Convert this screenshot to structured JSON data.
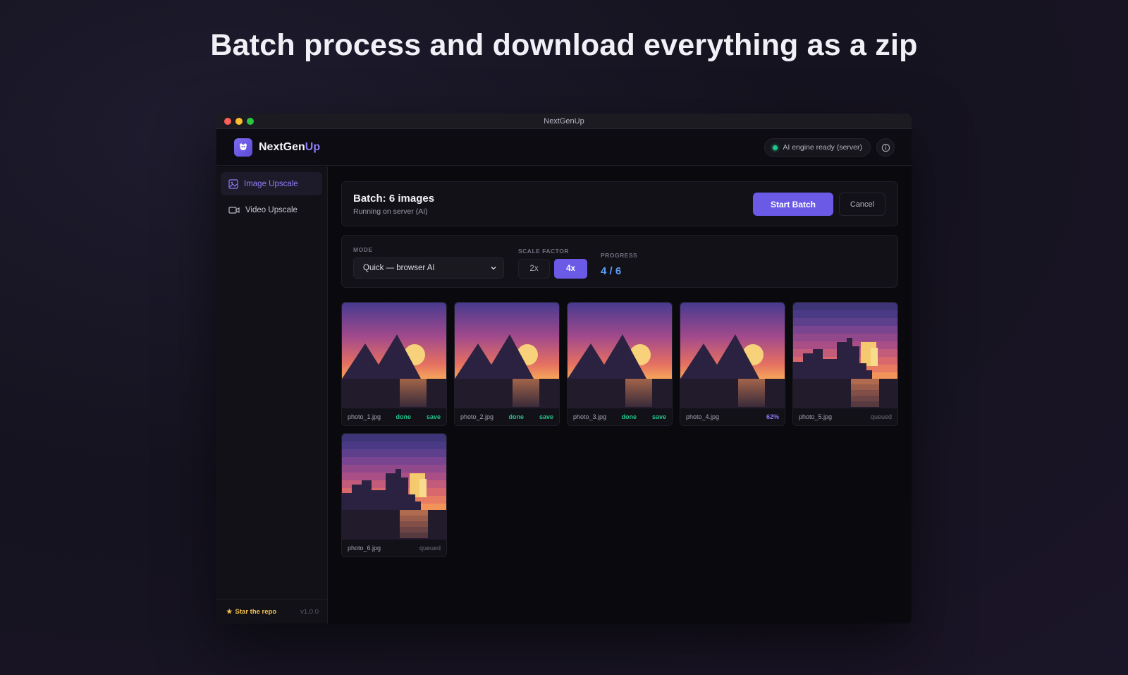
{
  "headline": "Batch process and download everything as a zip",
  "window": {
    "title": "NextGenUp"
  },
  "header": {
    "brand_main": "NextGen",
    "brand_accent": "Up",
    "engine_status": "AI engine ready (server)",
    "info_icon": "info-icon"
  },
  "sidebar": {
    "items": [
      {
        "label": "Image Upscale",
        "icon": "image-icon",
        "active": true
      },
      {
        "label": "Video Upscale",
        "icon": "video-icon",
        "active": false
      }
    ],
    "footer": {
      "star_label": "Star the repo",
      "version": "v1.0.0"
    }
  },
  "batch": {
    "title": "Batch: 6 images",
    "subtitle": "Running on server (AI)",
    "start_label": "Start Batch",
    "cancel_label": "Cancel"
  },
  "settings": {
    "mode_label": "MODE",
    "mode_value": "Quick — browser AI",
    "scale_label": "SCALE FACTOR",
    "scale_options": [
      "2x",
      "4x"
    ],
    "scale_selected": "4x",
    "progress_label": "PROGRESS",
    "progress_value": "4 / 6"
  },
  "images": [
    {
      "name": "photo_1.jpg",
      "status": "done",
      "action": "save",
      "style": "smooth"
    },
    {
      "name": "photo_2.jpg",
      "status": "done",
      "action": "save",
      "style": "smooth"
    },
    {
      "name": "photo_3.jpg",
      "status": "done",
      "action": "save",
      "style": "smooth"
    },
    {
      "name": "photo_4.jpg",
      "status": "62%",
      "action": "",
      "style": "smooth"
    },
    {
      "name": "photo_5.jpg",
      "status": "queued",
      "action": "",
      "style": "pixel"
    },
    {
      "name": "photo_6.jpg",
      "status": "queued",
      "action": "",
      "style": "pixel"
    }
  ],
  "colors": {
    "accent": "#6b5ae6",
    "accent_text": "#8b7cf6",
    "success": "#22c58b",
    "progress": "#5b9df5",
    "star": "#f0c24e"
  }
}
